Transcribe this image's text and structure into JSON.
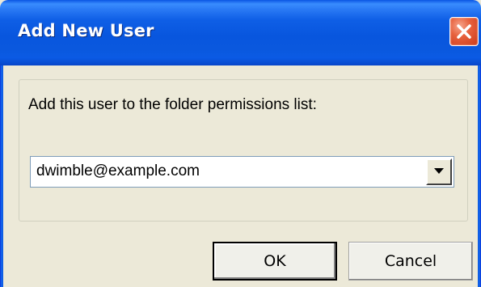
{
  "window": {
    "title": "Add New User",
    "close_icon": "close-icon"
  },
  "dialog": {
    "prompt": "Add this user to the folder permissions list:",
    "user_combo": {
      "value": "dwimble@example.com",
      "dropdown_icon": "chevron-down-icon"
    },
    "buttons": {
      "ok_label": "OK",
      "cancel_label": "Cancel"
    }
  },
  "colors": {
    "titlebar": "#0A58DE",
    "dialog_background": "#ECE9D8",
    "close_button": "#E7613D"
  }
}
